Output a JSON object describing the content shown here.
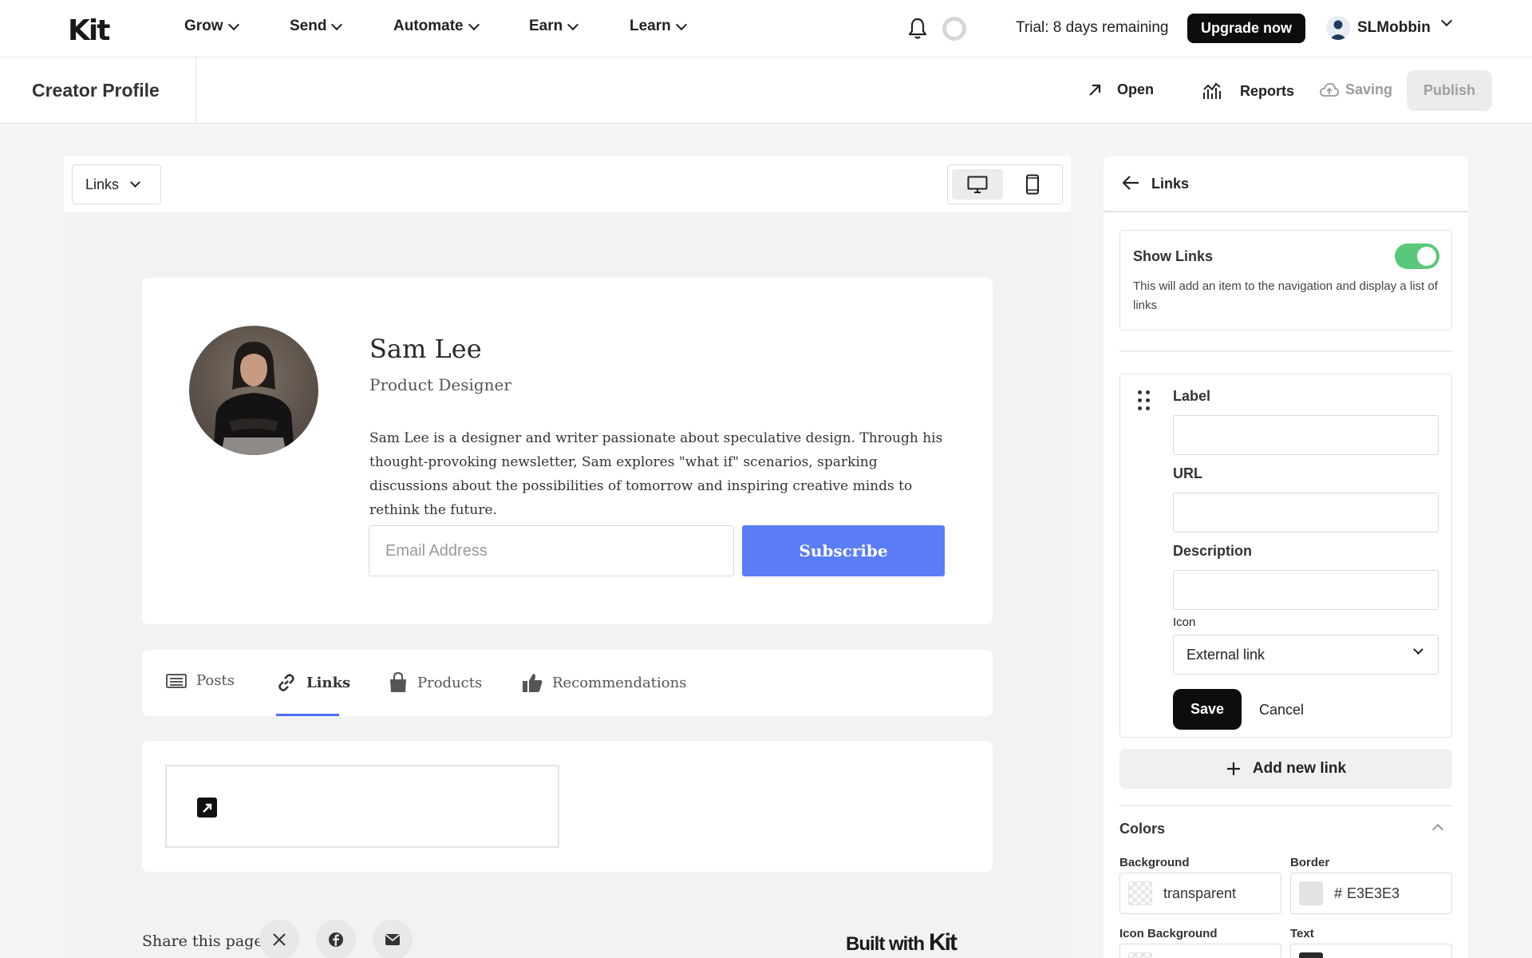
{
  "nav": {
    "logo": "Kit",
    "items": [
      {
        "label": "Grow"
      },
      {
        "label": "Send"
      },
      {
        "label": "Automate"
      },
      {
        "label": "Earn"
      },
      {
        "label": "Learn"
      }
    ],
    "trial_text": "Trial: 8 days remaining",
    "upgrade_label": "Upgrade now",
    "username": "SLMobbin"
  },
  "subbar": {
    "title": "Creator Profile",
    "open_label": "Open",
    "reports_label": "Reports",
    "saving_label": "Saving",
    "publish_label": "Publish"
  },
  "preview": {
    "page_select": "Links",
    "profile": {
      "name": "Sam Lee",
      "role": "Product Designer",
      "bio": "Sam Lee is a designer and writer passionate about speculative design. Through his thought-provoking newsletter, Sam explores \"what if\" scenarios, sparking discussions about the possibilities of tomorrow and inspiring creative minds to rethink the future.",
      "email_placeholder": "Email Address",
      "subscribe_label": "Subscribe"
    },
    "tabs": [
      {
        "label": "Posts"
      },
      {
        "label": "Links"
      },
      {
        "label": "Products"
      },
      {
        "label": "Recommendations"
      }
    ],
    "active_tab": "Links",
    "share_label": "Share this page",
    "built_with": "Built with",
    "built_with_brand": "Kit"
  },
  "panel": {
    "title": "Links",
    "show_links": {
      "title": "Show Links",
      "enabled": true,
      "description": "This will add an item to the navigation and display a list of links"
    },
    "form": {
      "label_label": "Label",
      "label_value": "",
      "url_label": "URL",
      "url_value": "",
      "description_label": "Description",
      "description_value": "",
      "icon_label": "Icon",
      "icon_value": "External link",
      "save_label": "Save",
      "cancel_label": "Cancel"
    },
    "add_link_label": "Add new link",
    "colors": {
      "title": "Colors",
      "background_label": "Background",
      "background_value": "transparent",
      "border_label": "Border",
      "border_hash": "#",
      "border_value": "E3E3E3",
      "icon_background_label": "Icon Background",
      "text_label": "Text"
    }
  },
  "colors": {
    "accent": "#5a7cf5",
    "toggle_on": "#5ac87a",
    "tab_underline": "#4c6ef5",
    "border_swatch": "#e3e3e3"
  }
}
